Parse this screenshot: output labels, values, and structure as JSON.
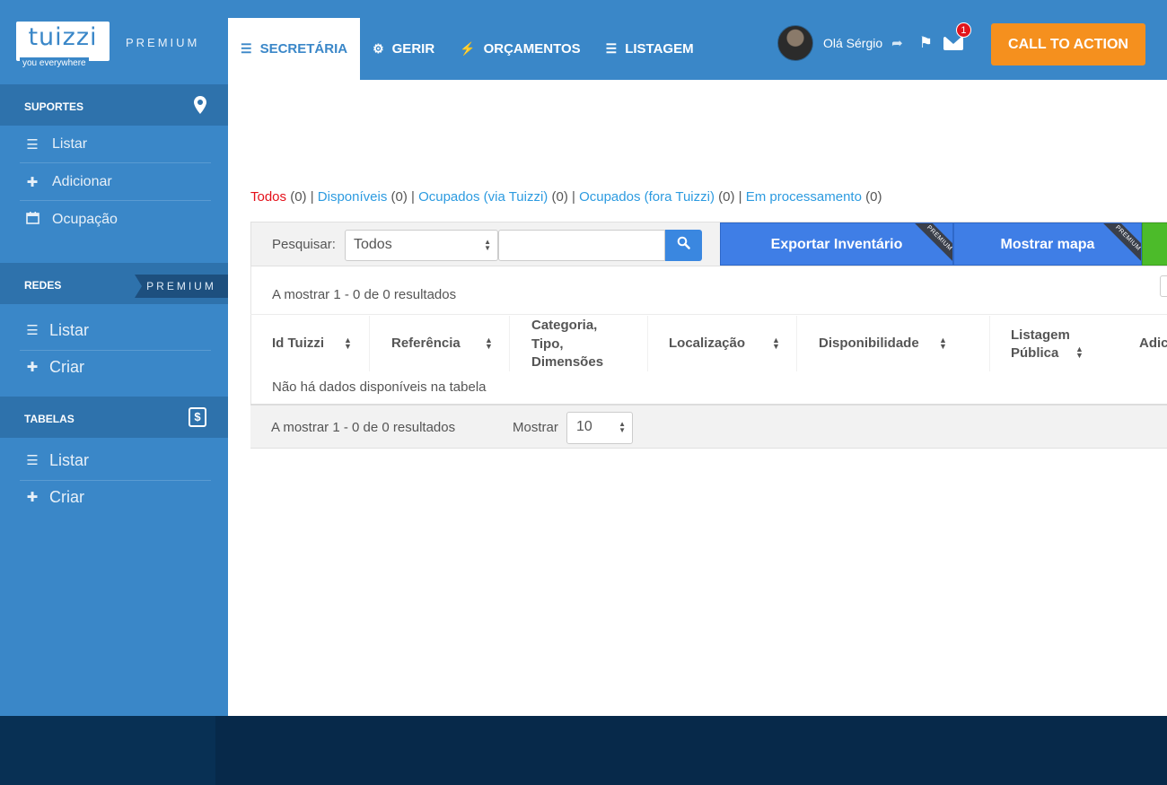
{
  "brand": {
    "logo_text": "tuizzi",
    "tagline": "you everywhere",
    "edition": "PREMIUM"
  },
  "nav": {
    "items": [
      {
        "label": "SECRETÁRIA",
        "icon": "list-icon",
        "active": true
      },
      {
        "label": "GERIR",
        "icon": "cogs-icon",
        "active": false
      },
      {
        "label": "ORÇAMENTOS",
        "icon": "magic-wand-icon",
        "active": false
      },
      {
        "label": "LISTAGEM",
        "icon": "list-icon",
        "active": false
      }
    ]
  },
  "user": {
    "greeting": "Olá Sérgio",
    "notifications": "1"
  },
  "cta": {
    "label": "CALL TO ACTION",
    "color": "#f5901e"
  },
  "sidebar": {
    "suportes": {
      "title": "SUPORTES",
      "icon": "map-marker-icon",
      "items": [
        {
          "label": "Listar",
          "icon": "list-icon"
        },
        {
          "label": "Adicionar",
          "icon": "plus-icon"
        },
        {
          "label": "Ocupação",
          "icon": "calendar-icon"
        }
      ]
    },
    "redes": {
      "title": "REDES",
      "badge": "PREMIUM",
      "items": [
        {
          "label": "Listar",
          "icon": "list-icon"
        },
        {
          "label": "Criar",
          "icon": "plus-icon"
        }
      ]
    },
    "tabelas": {
      "title": "TABELAS",
      "icon": "dollar-icon",
      "icon_glyph": "$",
      "items": [
        {
          "label": "Listar",
          "icon": "list-icon"
        },
        {
          "label": "Criar",
          "icon": "plus-icon"
        }
      ]
    }
  },
  "filters": [
    {
      "label": "Todos",
      "count": "(0)",
      "active": true
    },
    {
      "label": "Disponíveis",
      "count": "(0)",
      "active": false
    },
    {
      "label": "Ocupados (via Tuizzi)",
      "count": "(0)",
      "active": false
    },
    {
      "label": "Ocupados (fora Tuizzi)",
      "count": "(0)",
      "active": false
    },
    {
      "label": "Em processamento",
      "count": "(0)",
      "active": false
    }
  ],
  "toolbar": {
    "search_label": "Pesquisar:",
    "select_value": "Todos",
    "search_placeholder": "",
    "export_label": "Exportar Inventário",
    "map_label": "Mostrar mapa",
    "ribbon_label": "PREMIUM"
  },
  "table": {
    "count_text": "A mostrar 1 - 0 de 0 resultados",
    "columns": [
      "Id Tuizzi",
      "Referência",
      "Categoria, Tipo, Dimensões",
      "Localização",
      "Disponibilidade",
      "Listagem Pública",
      "Adic"
    ],
    "empty_message": "Não há dados disponíveis na tabela",
    "show_label": "Mostrar",
    "page_size": "10"
  }
}
